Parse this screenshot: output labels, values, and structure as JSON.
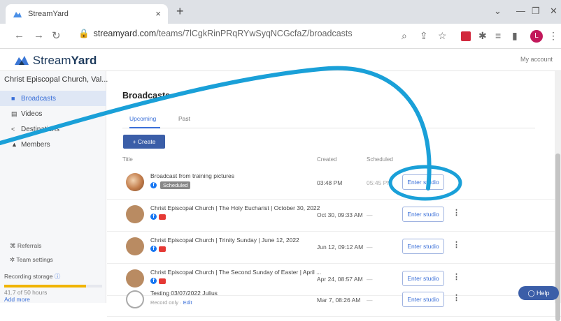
{
  "browser": {
    "tab_title": "StreamYard",
    "tab_close": "×",
    "new_tab": "+",
    "url_domain": "streamyard.com",
    "url_path": "/teams/7lCgkRinPRqRYwSyqNCGcfaZ/broadcasts",
    "profile_initial": "L"
  },
  "header": {
    "logo_light": "Stream",
    "logo_bold": "Yard",
    "my_account": "My account"
  },
  "sidebar": {
    "team_name": "Christ Episcopal Church, Val...",
    "items": [
      {
        "label": "Broadcasts"
      },
      {
        "label": "Videos"
      },
      {
        "label": "Destinations"
      },
      {
        "label": "Members"
      }
    ],
    "referrals": "Referrals",
    "team_settings": "Team settings",
    "recording_storage": "Recording storage",
    "hours": "41.7 of 50 hours",
    "add_more": "Add more",
    "storage_used_fraction": 0.834
  },
  "main": {
    "title": "Broadcasts",
    "tabs": [
      {
        "label": "Upcoming"
      },
      {
        "label": "Past"
      }
    ],
    "create_label": "Create",
    "columns": {
      "title": "Title",
      "created": "Created",
      "scheduled": "Scheduled"
    },
    "rows": [
      {
        "title": "Broadcast from training pictures",
        "badge": "Scheduled",
        "created": "03:48 PM",
        "scheduled": "05:45 PM",
        "button": "Enter studio"
      },
      {
        "title": "Christ Episcopal Church | The Holy Eucharist | October 30, 2022",
        "created": "Oct 30, 09:33 AM",
        "scheduled": "—",
        "button": "Enter studio"
      },
      {
        "title": "Christ Episcopal Church | Trinity Sunday | June 12, 2022",
        "created": "Jun 12, 09:12 AM",
        "scheduled": "—",
        "button": "Enter studio"
      },
      {
        "title": "Christ Episcopal Church | The Second Sunday of Easter | April ...",
        "created": "Apr 24, 08:57 AM",
        "scheduled": "—",
        "button": "Enter studio"
      },
      {
        "title": "Testing 03/07/2022 Julius",
        "sub": "Record only",
        "sub_link": "Edit",
        "created": "Mar 7, 08:26 AM",
        "scheduled": "—",
        "button": "Enter studio"
      }
    ]
  },
  "help_label": "Help",
  "colors": {
    "accent": "#3b5ea8",
    "annotation": "#1aa0d8"
  }
}
